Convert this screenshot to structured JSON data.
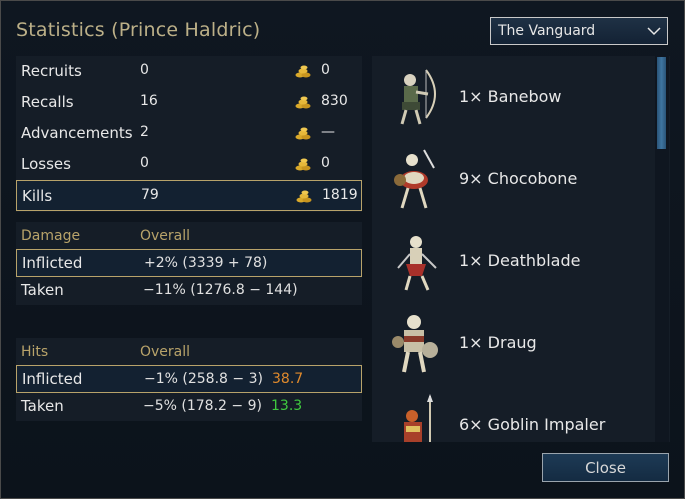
{
  "title": "Statistics (Prince Haldric)",
  "faction_select": {
    "value": "The Vanguard"
  },
  "stats": [
    {
      "label": "Recruits",
      "value": "0",
      "gold": "0"
    },
    {
      "label": "Recalls",
      "value": "16",
      "gold": "830"
    },
    {
      "label": "Advancements",
      "value": "2",
      "gold": "—"
    },
    {
      "label": "Losses",
      "value": "0",
      "gold": "0"
    },
    {
      "label": "Kills",
      "value": "79",
      "gold": "1819"
    }
  ],
  "damage": {
    "header": "Damage",
    "overall_header": "Overall",
    "inflicted_label": "Inflicted",
    "inflicted_value": "+2% (3339 + 78)",
    "taken_label": "Taken",
    "taken_value": "−11% (1276.8 − 144)"
  },
  "hits": {
    "header": "Hits",
    "overall_header": "Overall",
    "inflicted_label": "Inflicted",
    "inflicted_value": "−1% (258.8 − 3)",
    "inflicted_extra": "38.7",
    "taken_label": "Taken",
    "taken_value": "−5% (178.2 − 9)",
    "taken_extra": "13.3"
  },
  "units": [
    {
      "label": "1× Banebow"
    },
    {
      "label": "9× Chocobone"
    },
    {
      "label": "1× Deathblade"
    },
    {
      "label": "1× Draug"
    },
    {
      "label": "6× Goblin Impaler"
    }
  ],
  "close_label": "Close",
  "colors": {
    "title": "#bcb088",
    "accent_gold": "#b8a36a",
    "extra_orange": "#e08a2c",
    "extra_green": "#3fc93f"
  }
}
